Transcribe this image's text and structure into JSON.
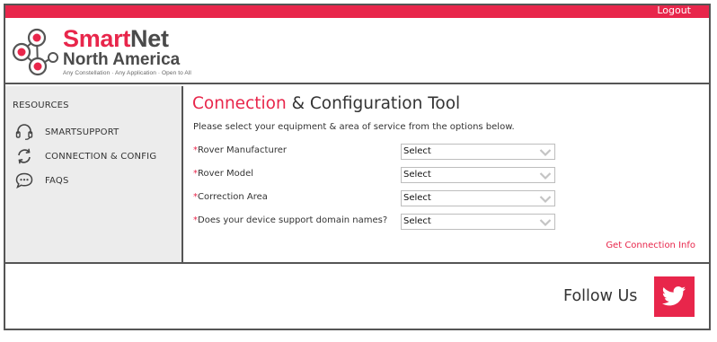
{
  "header": {
    "logout_label": "Logout",
    "brand_smart": "Smart",
    "brand_net": "Net",
    "brand_region": "North America",
    "tagline": "Any Constellation · Any Application · Open to All"
  },
  "sidebar": {
    "heading": "RESOURCES",
    "items": [
      {
        "label": "SMARTSUPPORT",
        "icon": "headset-icon"
      },
      {
        "label": "CONNECTION & CONFIG",
        "icon": "refresh-cycle-icon"
      },
      {
        "label": "FAQS",
        "icon": "chat-bubble-icon"
      }
    ]
  },
  "main": {
    "title_accent": "Connection",
    "title_rest": " & Configuration Tool",
    "instruction": "Please select your equipment & area of service from the options below.",
    "required_marker": "*",
    "fields": [
      {
        "label": "Rover Manufacturer",
        "value": "Select"
      },
      {
        "label": "Rover Model",
        "value": "Select"
      },
      {
        "label": "Correction Area",
        "value": "Select"
      },
      {
        "label": "Does your device support domain names?",
        "value": "Select"
      }
    ],
    "get_info_label": "Get Connection Info"
  },
  "footer": {
    "follow_label": "Follow Us",
    "social_icon": "twitter-icon"
  },
  "colors": {
    "accent": "#e8264b",
    "sidebar_bg": "#ececec",
    "border": "#555555"
  }
}
